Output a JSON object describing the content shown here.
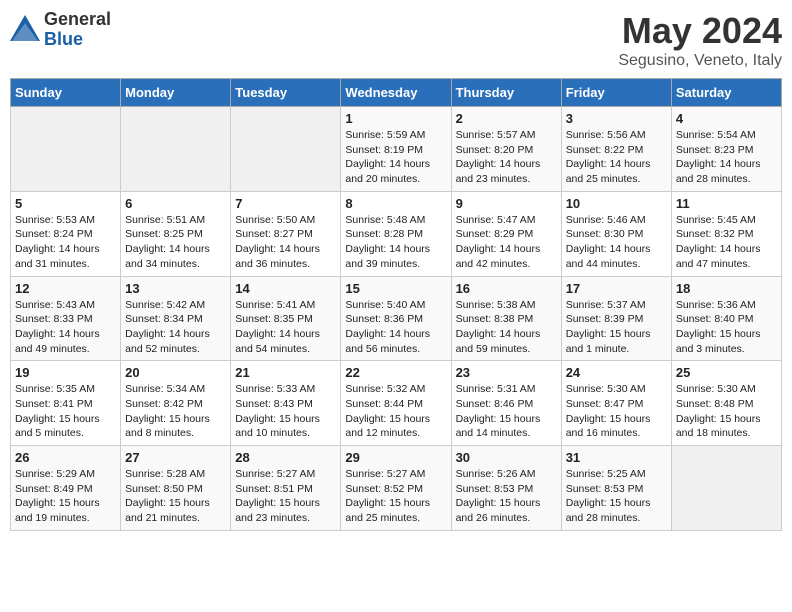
{
  "header": {
    "logo_general": "General",
    "logo_blue": "Blue",
    "month_title": "May 2024",
    "subtitle": "Segusino, Veneto, Italy"
  },
  "days_of_week": [
    "Sunday",
    "Monday",
    "Tuesday",
    "Wednesday",
    "Thursday",
    "Friday",
    "Saturday"
  ],
  "weeks": [
    [
      {
        "day": "",
        "sunrise": "",
        "sunset": "",
        "daylight": ""
      },
      {
        "day": "",
        "sunrise": "",
        "sunset": "",
        "daylight": ""
      },
      {
        "day": "",
        "sunrise": "",
        "sunset": "",
        "daylight": ""
      },
      {
        "day": "1",
        "sunrise": "Sunrise: 5:59 AM",
        "sunset": "Sunset: 8:19 PM",
        "daylight": "Daylight: 14 hours and 20 minutes."
      },
      {
        "day": "2",
        "sunrise": "Sunrise: 5:57 AM",
        "sunset": "Sunset: 8:20 PM",
        "daylight": "Daylight: 14 hours and 23 minutes."
      },
      {
        "day": "3",
        "sunrise": "Sunrise: 5:56 AM",
        "sunset": "Sunset: 8:22 PM",
        "daylight": "Daylight: 14 hours and 25 minutes."
      },
      {
        "day": "4",
        "sunrise": "Sunrise: 5:54 AM",
        "sunset": "Sunset: 8:23 PM",
        "daylight": "Daylight: 14 hours and 28 minutes."
      }
    ],
    [
      {
        "day": "5",
        "sunrise": "Sunrise: 5:53 AM",
        "sunset": "Sunset: 8:24 PM",
        "daylight": "Daylight: 14 hours and 31 minutes."
      },
      {
        "day": "6",
        "sunrise": "Sunrise: 5:51 AM",
        "sunset": "Sunset: 8:25 PM",
        "daylight": "Daylight: 14 hours and 34 minutes."
      },
      {
        "day": "7",
        "sunrise": "Sunrise: 5:50 AM",
        "sunset": "Sunset: 8:27 PM",
        "daylight": "Daylight: 14 hours and 36 minutes."
      },
      {
        "day": "8",
        "sunrise": "Sunrise: 5:48 AM",
        "sunset": "Sunset: 8:28 PM",
        "daylight": "Daylight: 14 hours and 39 minutes."
      },
      {
        "day": "9",
        "sunrise": "Sunrise: 5:47 AM",
        "sunset": "Sunset: 8:29 PM",
        "daylight": "Daylight: 14 hours and 42 minutes."
      },
      {
        "day": "10",
        "sunrise": "Sunrise: 5:46 AM",
        "sunset": "Sunset: 8:30 PM",
        "daylight": "Daylight: 14 hours and 44 minutes."
      },
      {
        "day": "11",
        "sunrise": "Sunrise: 5:45 AM",
        "sunset": "Sunset: 8:32 PM",
        "daylight": "Daylight: 14 hours and 47 minutes."
      }
    ],
    [
      {
        "day": "12",
        "sunrise": "Sunrise: 5:43 AM",
        "sunset": "Sunset: 8:33 PM",
        "daylight": "Daylight: 14 hours and 49 minutes."
      },
      {
        "day": "13",
        "sunrise": "Sunrise: 5:42 AM",
        "sunset": "Sunset: 8:34 PM",
        "daylight": "Daylight: 14 hours and 52 minutes."
      },
      {
        "day": "14",
        "sunrise": "Sunrise: 5:41 AM",
        "sunset": "Sunset: 8:35 PM",
        "daylight": "Daylight: 14 hours and 54 minutes."
      },
      {
        "day": "15",
        "sunrise": "Sunrise: 5:40 AM",
        "sunset": "Sunset: 8:36 PM",
        "daylight": "Daylight: 14 hours and 56 minutes."
      },
      {
        "day": "16",
        "sunrise": "Sunrise: 5:38 AM",
        "sunset": "Sunset: 8:38 PM",
        "daylight": "Daylight: 14 hours and 59 minutes."
      },
      {
        "day": "17",
        "sunrise": "Sunrise: 5:37 AM",
        "sunset": "Sunset: 8:39 PM",
        "daylight": "Daylight: 15 hours and 1 minute."
      },
      {
        "day": "18",
        "sunrise": "Sunrise: 5:36 AM",
        "sunset": "Sunset: 8:40 PM",
        "daylight": "Daylight: 15 hours and 3 minutes."
      }
    ],
    [
      {
        "day": "19",
        "sunrise": "Sunrise: 5:35 AM",
        "sunset": "Sunset: 8:41 PM",
        "daylight": "Daylight: 15 hours and 5 minutes."
      },
      {
        "day": "20",
        "sunrise": "Sunrise: 5:34 AM",
        "sunset": "Sunset: 8:42 PM",
        "daylight": "Daylight: 15 hours and 8 minutes."
      },
      {
        "day": "21",
        "sunrise": "Sunrise: 5:33 AM",
        "sunset": "Sunset: 8:43 PM",
        "daylight": "Daylight: 15 hours and 10 minutes."
      },
      {
        "day": "22",
        "sunrise": "Sunrise: 5:32 AM",
        "sunset": "Sunset: 8:44 PM",
        "daylight": "Daylight: 15 hours and 12 minutes."
      },
      {
        "day": "23",
        "sunrise": "Sunrise: 5:31 AM",
        "sunset": "Sunset: 8:46 PM",
        "daylight": "Daylight: 15 hours and 14 minutes."
      },
      {
        "day": "24",
        "sunrise": "Sunrise: 5:30 AM",
        "sunset": "Sunset: 8:47 PM",
        "daylight": "Daylight: 15 hours and 16 minutes."
      },
      {
        "day": "25",
        "sunrise": "Sunrise: 5:30 AM",
        "sunset": "Sunset: 8:48 PM",
        "daylight": "Daylight: 15 hours and 18 minutes."
      }
    ],
    [
      {
        "day": "26",
        "sunrise": "Sunrise: 5:29 AM",
        "sunset": "Sunset: 8:49 PM",
        "daylight": "Daylight: 15 hours and 19 minutes."
      },
      {
        "day": "27",
        "sunrise": "Sunrise: 5:28 AM",
        "sunset": "Sunset: 8:50 PM",
        "daylight": "Daylight: 15 hours and 21 minutes."
      },
      {
        "day": "28",
        "sunrise": "Sunrise: 5:27 AM",
        "sunset": "Sunset: 8:51 PM",
        "daylight": "Daylight: 15 hours and 23 minutes."
      },
      {
        "day": "29",
        "sunrise": "Sunrise: 5:27 AM",
        "sunset": "Sunset: 8:52 PM",
        "daylight": "Daylight: 15 hours and 25 minutes."
      },
      {
        "day": "30",
        "sunrise": "Sunrise: 5:26 AM",
        "sunset": "Sunset: 8:53 PM",
        "daylight": "Daylight: 15 hours and 26 minutes."
      },
      {
        "day": "31",
        "sunrise": "Sunrise: 5:25 AM",
        "sunset": "Sunset: 8:53 PM",
        "daylight": "Daylight: 15 hours and 28 minutes."
      },
      {
        "day": "",
        "sunrise": "",
        "sunset": "",
        "daylight": ""
      }
    ]
  ]
}
